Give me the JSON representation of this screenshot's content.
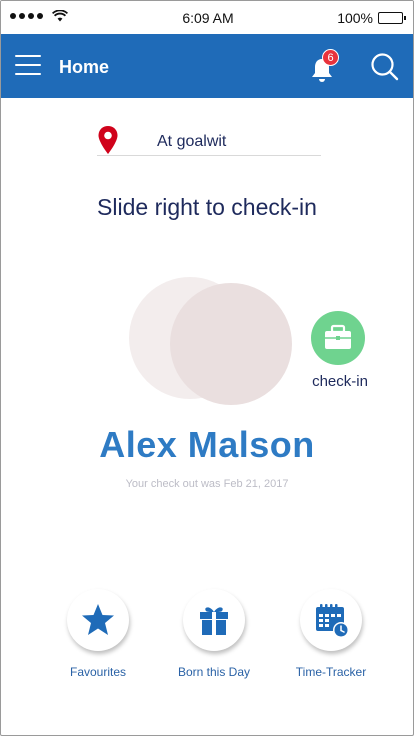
{
  "status_bar": {
    "time": "6:09 AM",
    "battery": "100%"
  },
  "header": {
    "title": "Home",
    "notification_count": "6"
  },
  "location": {
    "label": "At goalwit"
  },
  "slide": {
    "instruction": "Slide right to check-in",
    "action_label": "check-in"
  },
  "user": {
    "name": "Alex Malson",
    "last_checkout": "Your check out was Feb 21, 2017"
  },
  "actions": [
    {
      "label": "Favourites",
      "icon": "star-icon"
    },
    {
      "label": "Born this Day",
      "icon": "gift-icon"
    },
    {
      "label": "Time-Tracker",
      "icon": "calendar-clock-icon"
    }
  ],
  "colors": {
    "header": "#1f6bb8",
    "accent": "#2e7bc4",
    "checkin": "#6fd38f",
    "badge": "#e8323c",
    "pin": "#d0021b"
  }
}
